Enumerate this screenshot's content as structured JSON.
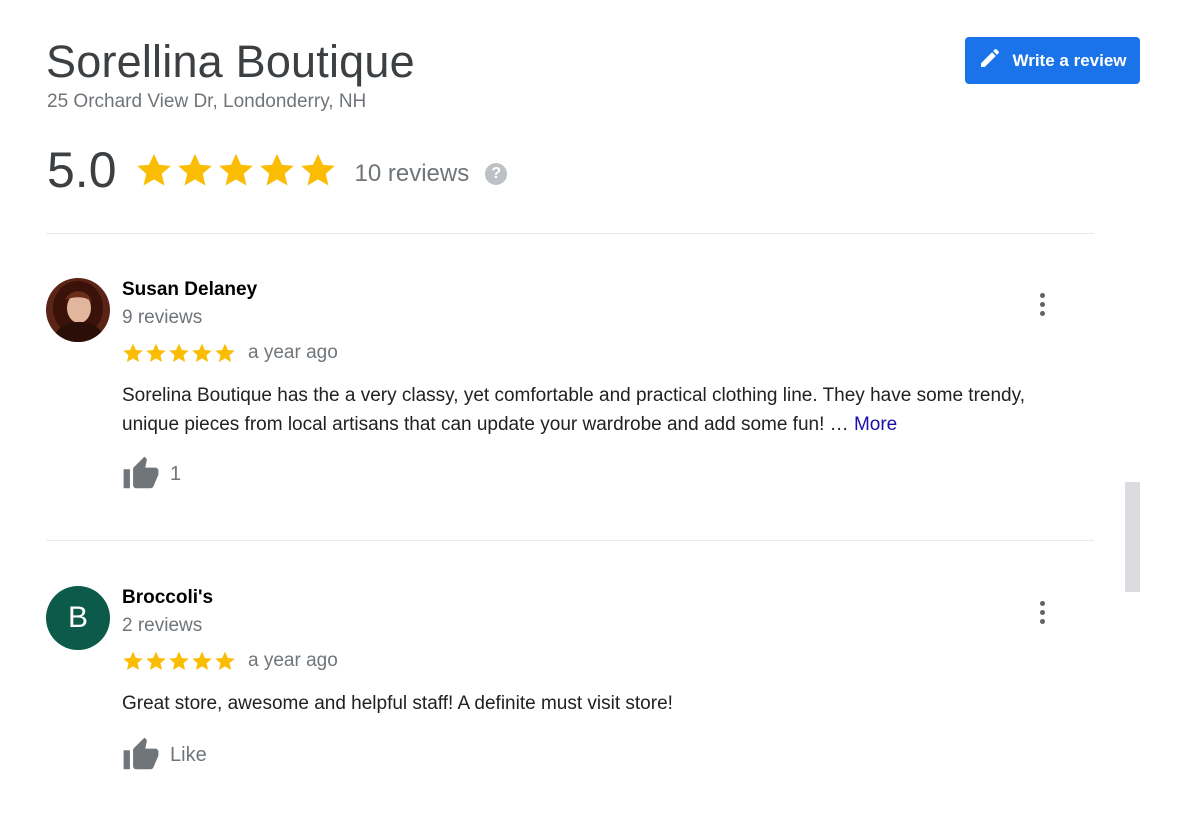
{
  "business": {
    "name": "Sorellina Boutique",
    "address": "25 Orchard View Dr, Londonderry, NH"
  },
  "write_review": {
    "label": "Write a review",
    "icon": "pencil-icon"
  },
  "summary": {
    "rating": "5.0",
    "stars": 5,
    "review_count": "10 reviews",
    "help_icon": "?"
  },
  "colors": {
    "accent": "#1a73e8",
    "star": "#fbbc04",
    "link": "#1a0dab",
    "avatar_green": "#0b5a4a"
  },
  "reviews": [
    {
      "name": "Susan Delaney",
      "review_count": "9 reviews",
      "stars": 5,
      "date": "a year ago",
      "text": "Sorelina Boutique has the a very classy, yet comfortable and practical clothing line. They have some trendy, unique pieces from local artisans that can update your wardrobe and add some fun! … ",
      "more": "More",
      "likes": "1",
      "avatar": "photo"
    },
    {
      "name": "Broccoli's",
      "review_count": "2 reviews",
      "stars": 5,
      "date": "a year ago",
      "text": "Great store, awesome and helpful staff! A definite must visit store!",
      "likes": "Like",
      "avatar_letter": "B"
    }
  ]
}
